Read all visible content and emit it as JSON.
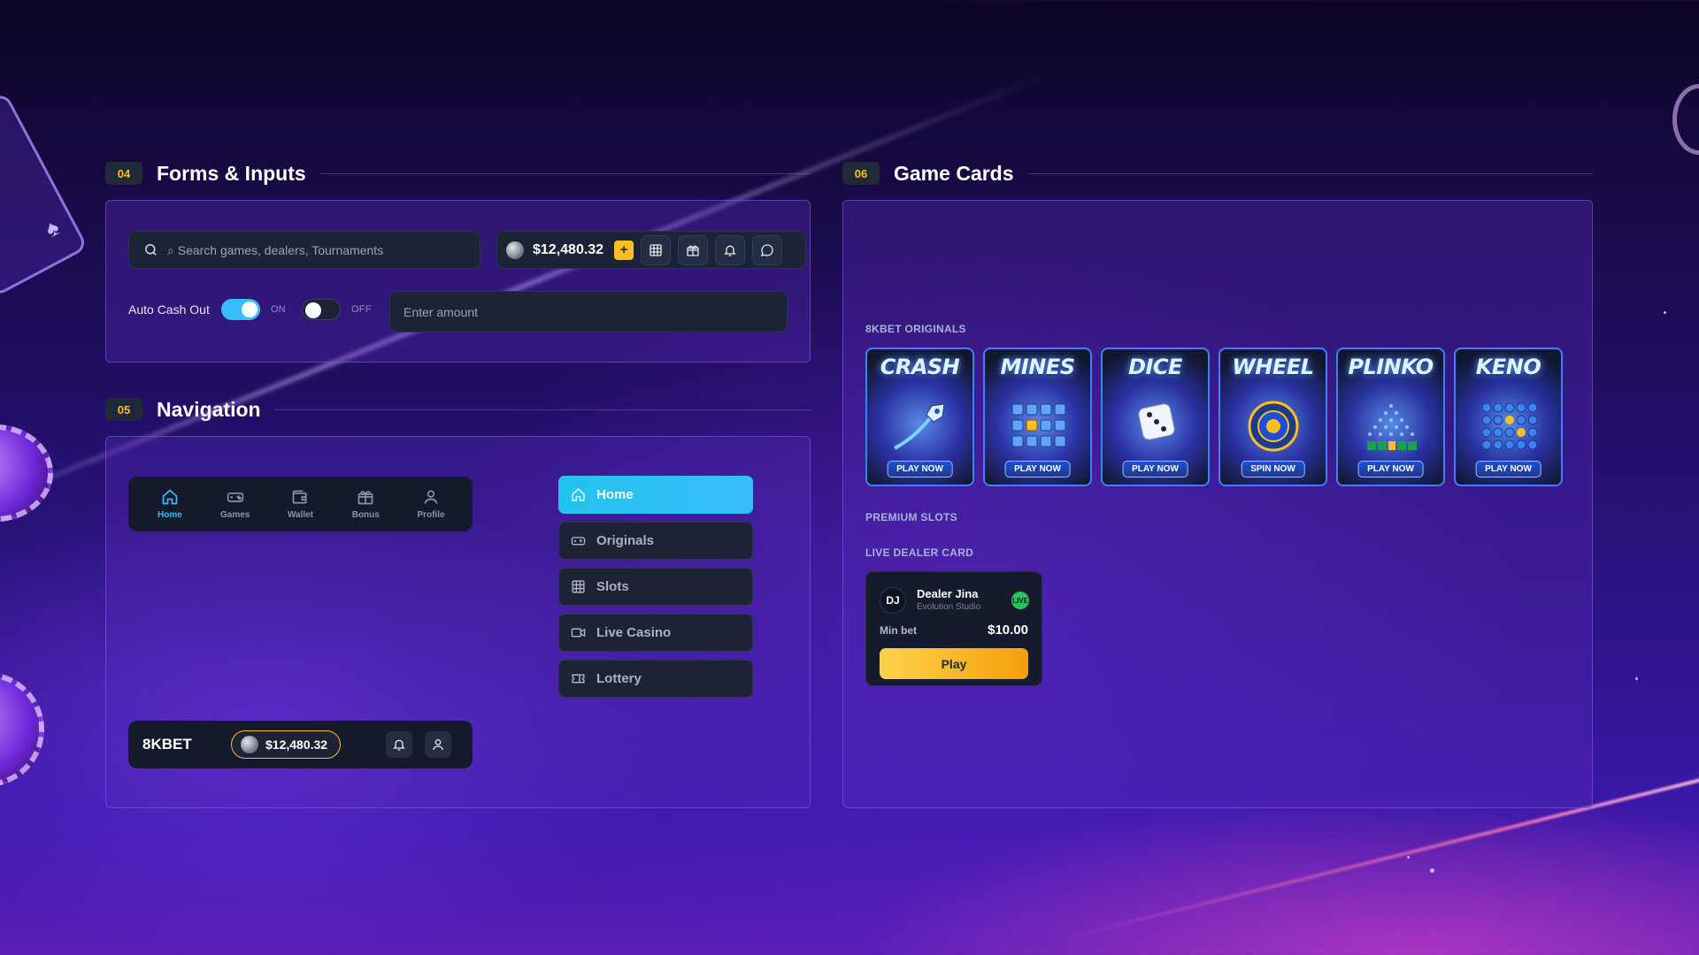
{
  "forms": {
    "num": "04",
    "title": "Forms & Inputs",
    "search_placeholder": "⌕ Search games, dealers, Tournaments",
    "balance": "$12,480.32",
    "plus": "+",
    "toggle_label": "Auto Cash Out",
    "toggle_on_text": "ON",
    "toggle_off_text": "OFF",
    "toggle_on_checked": true,
    "toggle_off_checked": false,
    "amount_placeholder": "Enter amount"
  },
  "navigation": {
    "num": "05",
    "title": "Navigation",
    "bottom_nav": [
      {
        "label": "Home",
        "icon": "home-icon",
        "active": true
      },
      {
        "label": "Games",
        "icon": "gamepad-icon",
        "active": false
      },
      {
        "label": "Wallet",
        "icon": "wallet-icon",
        "active": false
      },
      {
        "label": "Bonus",
        "icon": "gift-icon",
        "active": false
      },
      {
        "label": "Profile",
        "icon": "user-icon",
        "active": false
      }
    ],
    "side_menu": [
      {
        "label": "Home",
        "icon": "home-icon",
        "active": true
      },
      {
        "label": "Originals",
        "icon": "gamepad-icon",
        "active": false
      },
      {
        "label": "Slots",
        "icon": "grid-icon",
        "active": false
      },
      {
        "label": "Live Casino",
        "icon": "video-icon",
        "active": false
      },
      {
        "label": "Lottery",
        "icon": "ticket-icon",
        "active": false
      }
    ],
    "top_bar": {
      "brand": "8KBET",
      "balance": "$12,480.32"
    }
  },
  "game_cards": {
    "num": "06",
    "title": "Game Cards",
    "originals_label": "8KBET ORIGINALS",
    "premium_label": "PREMIUM SLOTS",
    "live_label": "LIVE DEALER CARD",
    "games": [
      {
        "title": "CRASH",
        "cta": "PLAY NOW"
      },
      {
        "title": "MINES",
        "cta": "PLAY NOW"
      },
      {
        "title": "DICE",
        "cta": "PLAY NOW"
      },
      {
        "title": "WHEEL",
        "cta": "SPIN NOW"
      },
      {
        "title": "PLINKO",
        "cta": "PLAY NOW"
      },
      {
        "title": "KENO",
        "cta": "PLAY NOW"
      }
    ],
    "dealer": {
      "initials": "DJ",
      "name": "Dealer Jina",
      "studio": "Evolution Studio",
      "live": "LIVE",
      "minbet_label": "Min bet",
      "minbet_value": "$10.00",
      "play": "Play"
    }
  },
  "colors": {
    "accent_cyan": "#38bdf8",
    "accent_gold": "#fbbf24",
    "live_green": "#22c55e"
  }
}
